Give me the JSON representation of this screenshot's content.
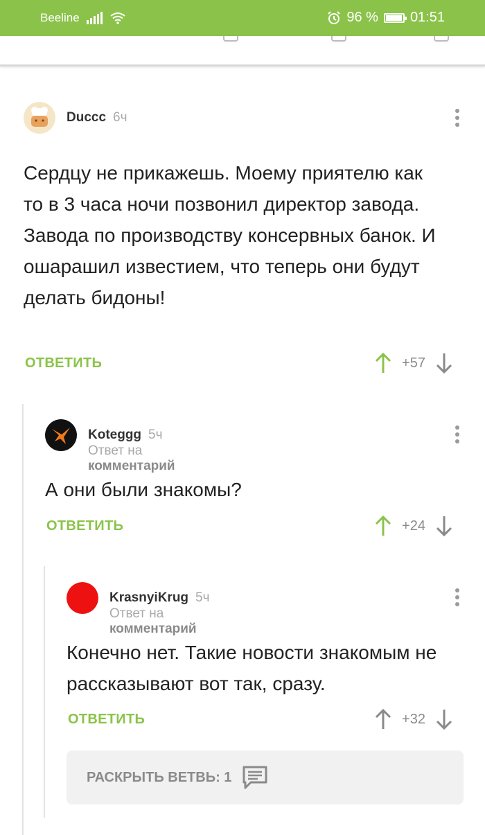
{
  "status_bar": {
    "carrier": "Beeline",
    "battery": "96 %",
    "battery_level": 0.96,
    "time": "01:51"
  },
  "comments": [
    {
      "username": "Duccc",
      "time": "6ч",
      "text": "Сердцу не прикажешь. Моему приятелю как то в 3 часа ночи позвонил директор завода. Завода по производству консервных банок. И ошарашил известием, что теперь они будут делать бидоны!",
      "reply_label": "ОТВЕТИТЬ",
      "score": "+57",
      "upvoted": true
    },
    {
      "username": "Koteggg",
      "time": "5ч",
      "reply_to_prefix": "Ответ на",
      "reply_to_link": "комментарий",
      "text": "А они были знакомы?",
      "reply_label": "ОТВЕТИТЬ",
      "score": "+24",
      "upvoted": true
    },
    {
      "username": "KrasnyiKrug",
      "time": "5ч",
      "reply_to_prefix": "Ответ на",
      "reply_to_link": "комментарий",
      "text": "Конечно нет. Такие новости знакомым не рассказывают вот так, сразу.",
      "reply_label": "ОТВЕТИТЬ",
      "score": "+32",
      "upvoted": false
    }
  ],
  "expand_branch": {
    "label": "РАСКРЫТЬ ВЕТВЬ: 1",
    "icon": "comment-icon"
  },
  "colors": {
    "accent": "#8bc34a",
    "muted": "#a9a9a9",
    "text": "#222222"
  }
}
